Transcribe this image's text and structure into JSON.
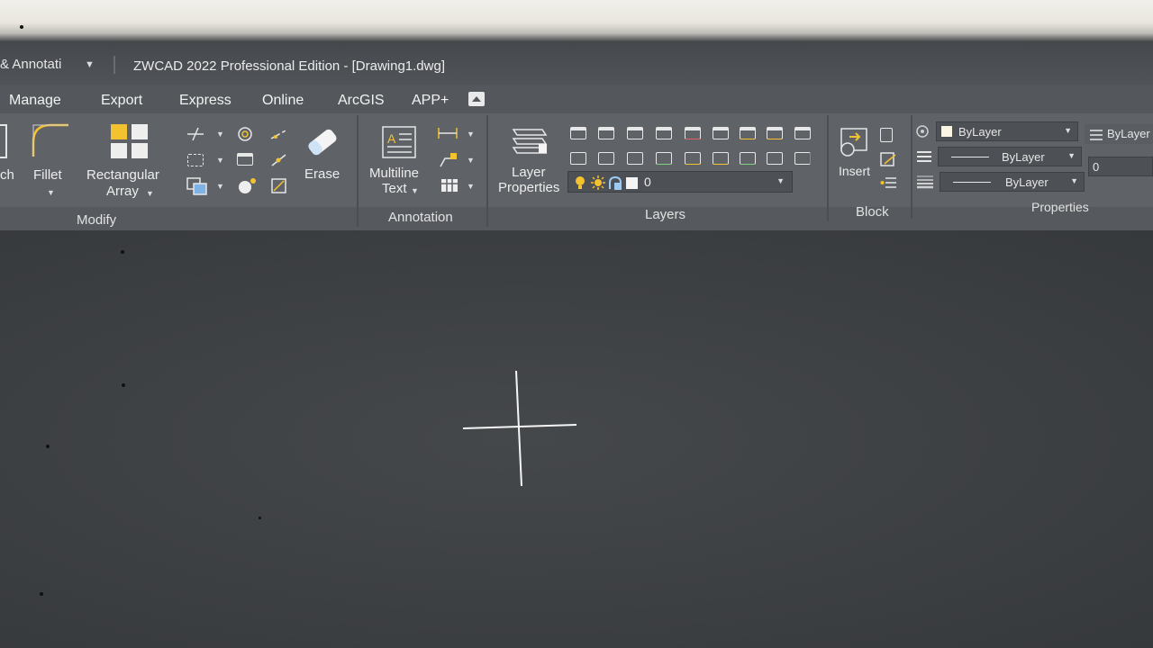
{
  "window": {
    "quick_access_label": "& Annotati",
    "title": "ZWCAD 2022 Professional Edition - [Drawing1.dwg]"
  },
  "menu": {
    "items": [
      "Manage",
      "Export",
      "Express",
      "Online",
      "ArcGIS",
      "APP+"
    ]
  },
  "ribbon": {
    "modify": {
      "partial_label": "ch",
      "fillet_label": "Fillet",
      "array_label_line1": "Rectangular",
      "array_label_line2": "Array",
      "erase_label": "Erase",
      "panel_label": "Modify"
    },
    "annotation": {
      "mtext_line1": "Multiline",
      "mtext_line2": "Text",
      "panel_label": "Annotation"
    },
    "layers": {
      "layer_props_line1": "Layer",
      "layer_props_line2": "Properties",
      "current_layer": "0",
      "panel_label": "Layers"
    },
    "block": {
      "insert_label": "Insert",
      "panel_label": "Block"
    },
    "properties": {
      "color": "ByLayer",
      "linetype": "ByLayer",
      "lineweight": "ByLayer",
      "right_combo": "ByLayer",
      "right_value": "0",
      "panel_label": "Properties"
    }
  },
  "colors": {
    "accent_yellow": "#f2c230",
    "ribbon_bg": "#5f6368",
    "canvas_bg": "#3d4043"
  }
}
